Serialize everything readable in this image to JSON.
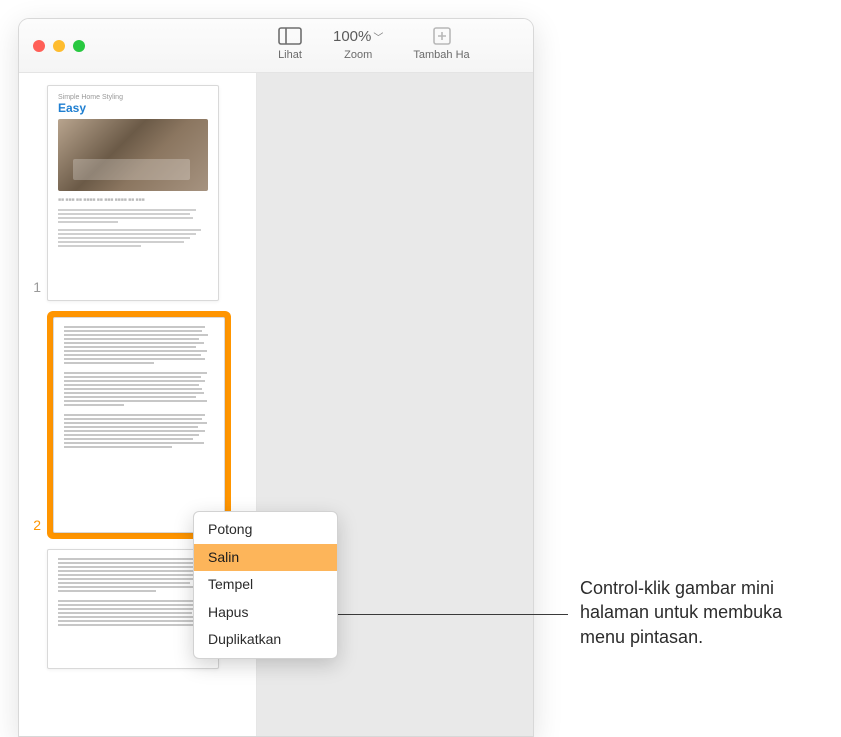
{
  "toolbar": {
    "view_label": "Lihat",
    "zoom_label": "Zoom",
    "zoom_value": "100%",
    "add_label": "Tambah Ha"
  },
  "thumbnails": {
    "page1_num": "1",
    "page2_num": "2",
    "page1_heading_small": "Simple Home Styling",
    "page1_heading_large": "Easy"
  },
  "context_menu": {
    "items": [
      {
        "label": "Potong"
      },
      {
        "label": "Salin"
      },
      {
        "label": "Tempel"
      },
      {
        "label": "Hapus"
      },
      {
        "label": "Duplikatkan"
      }
    ],
    "highlighted_index": 1
  },
  "callout": {
    "text": "Control-klik gambar mini halaman untuk membuka menu pintasan."
  }
}
